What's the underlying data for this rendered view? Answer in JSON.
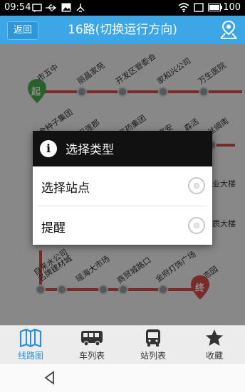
{
  "status_bar": {
    "time": "09:54",
    "battery": "100",
    "icons": [
      "message-icon",
      "usb-icon",
      "image-icon",
      "debug-icon",
      "wifi-icon",
      "sim-icon",
      "battery-icon"
    ]
  },
  "header": {
    "back_label": "返回",
    "title": "16路(切换运行方向)",
    "map_icon": "map-marker-icon"
  },
  "route": {
    "start_badge": "起",
    "end_badge": "终",
    "stops_row1": [
      "市五中",
      "丽晶家苑",
      "开发区管委会",
      "家和兴公司",
      "万生医院"
    ],
    "stops_row2_partial": [
      "金种子集团",
      "采莲郡",
      "医药集团",
      "富安",
      "森活",
      "九丝绸南"
    ],
    "stops_side_partial": [
      "业大楼",
      "质大楼"
    ],
    "stops_bottom": [
      "自来水公司名牌建材城",
      "瑶海大市场",
      "商贸城路口",
      "金府灯饰广场",
      "生态园"
    ]
  },
  "dialog": {
    "title": "选择类型",
    "info_icon": "info-icon",
    "options": [
      {
        "label": "选择站点",
        "selected": false
      },
      {
        "label": "提醒",
        "selected": false
      }
    ]
  },
  "tabs": [
    {
      "label": "线路图",
      "icon": "map-book-icon",
      "active": true
    },
    {
      "label": "车列表",
      "icon": "bus-side-icon",
      "active": false
    },
    {
      "label": "站列表",
      "icon": "bus-front-icon",
      "active": false
    },
    {
      "label": "收藏",
      "icon": "star-icon",
      "active": false
    }
  ],
  "colors": {
    "header_bg": "#3ca6e6",
    "route_red": "#e04d4d",
    "start_green": "#4caf50",
    "active_tab": "#2a8fd8"
  }
}
